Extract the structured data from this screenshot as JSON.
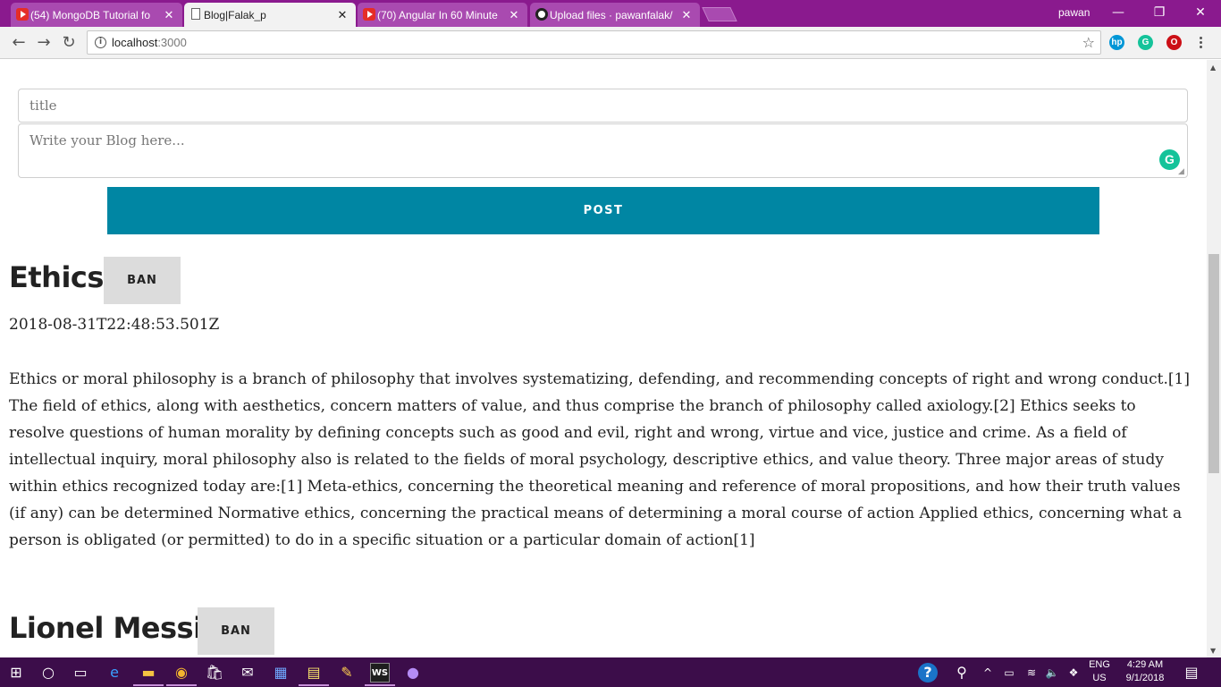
{
  "browser": {
    "tabs": [
      {
        "title": "(54) MongoDB Tutorial fo",
        "icon": "youtube-icon",
        "active": false
      },
      {
        "title": "Blog|Falak_p",
        "icon": "document-icon",
        "active": true
      },
      {
        "title": "(70) Angular In 60 Minute",
        "icon": "youtube-icon",
        "active": false
      },
      {
        "title": "Upload files · pawanfalak/",
        "icon": "github-icon",
        "active": false
      }
    ],
    "tab_close": "✕",
    "profile_name": "pawan",
    "window_controls": {
      "minimize": "—",
      "restore": "❐",
      "close": "✕"
    },
    "url_host": "localhost",
    "url_port": ":3000",
    "extensions": [
      {
        "name": "hp-icon",
        "label": "hp",
        "color": "#0096d6"
      },
      {
        "name": "grammarly-icon",
        "label": "G",
        "color": "#15c39a"
      },
      {
        "name": "opera-icon",
        "label": "O",
        "color": "#cc0f16"
      }
    ]
  },
  "form": {
    "title_placeholder": "title",
    "body_placeholder": "Write your Blog here...",
    "post_label": "POST",
    "accent_color": "#0086a3"
  },
  "posts": [
    {
      "title": "Ethics",
      "ban_label": "BAN",
      "date": "2018-08-31T22:48:53.501Z",
      "body": "Ethics or moral philosophy is a branch of philosophy that involves systematizing, defending, and recommending concepts of right and wrong conduct.[1] The field of ethics, along with aesthetics, concern matters of value, and thus comprise the branch of philosophy called axiology.[2] Ethics seeks to resolve questions of human morality by defining concepts such as good and evil, right and wrong, virtue and vice, justice and crime. As a field of intellectual inquiry, moral philosophy also is related to the fields of moral psychology, descriptive ethics, and value theory. Three major areas of study within ethics recognized today are:[1] Meta-ethics, concerning the theoretical meaning and reference of moral propositions, and how their truth values (if any) can be determined Normative ethics, concerning the practical means of determining a moral course of action Applied ethics, concerning what a person is obligated (or permitted) to do in a specific situation or a particular domain of action[1]"
    },
    {
      "title": "Lionel Messi",
      "ban_label": "BAN"
    }
  ],
  "taskbar": {
    "language": "ENG",
    "region": "US",
    "time": "4:29 AM",
    "date": "9/1/2018",
    "color": "#3c0d4a"
  }
}
